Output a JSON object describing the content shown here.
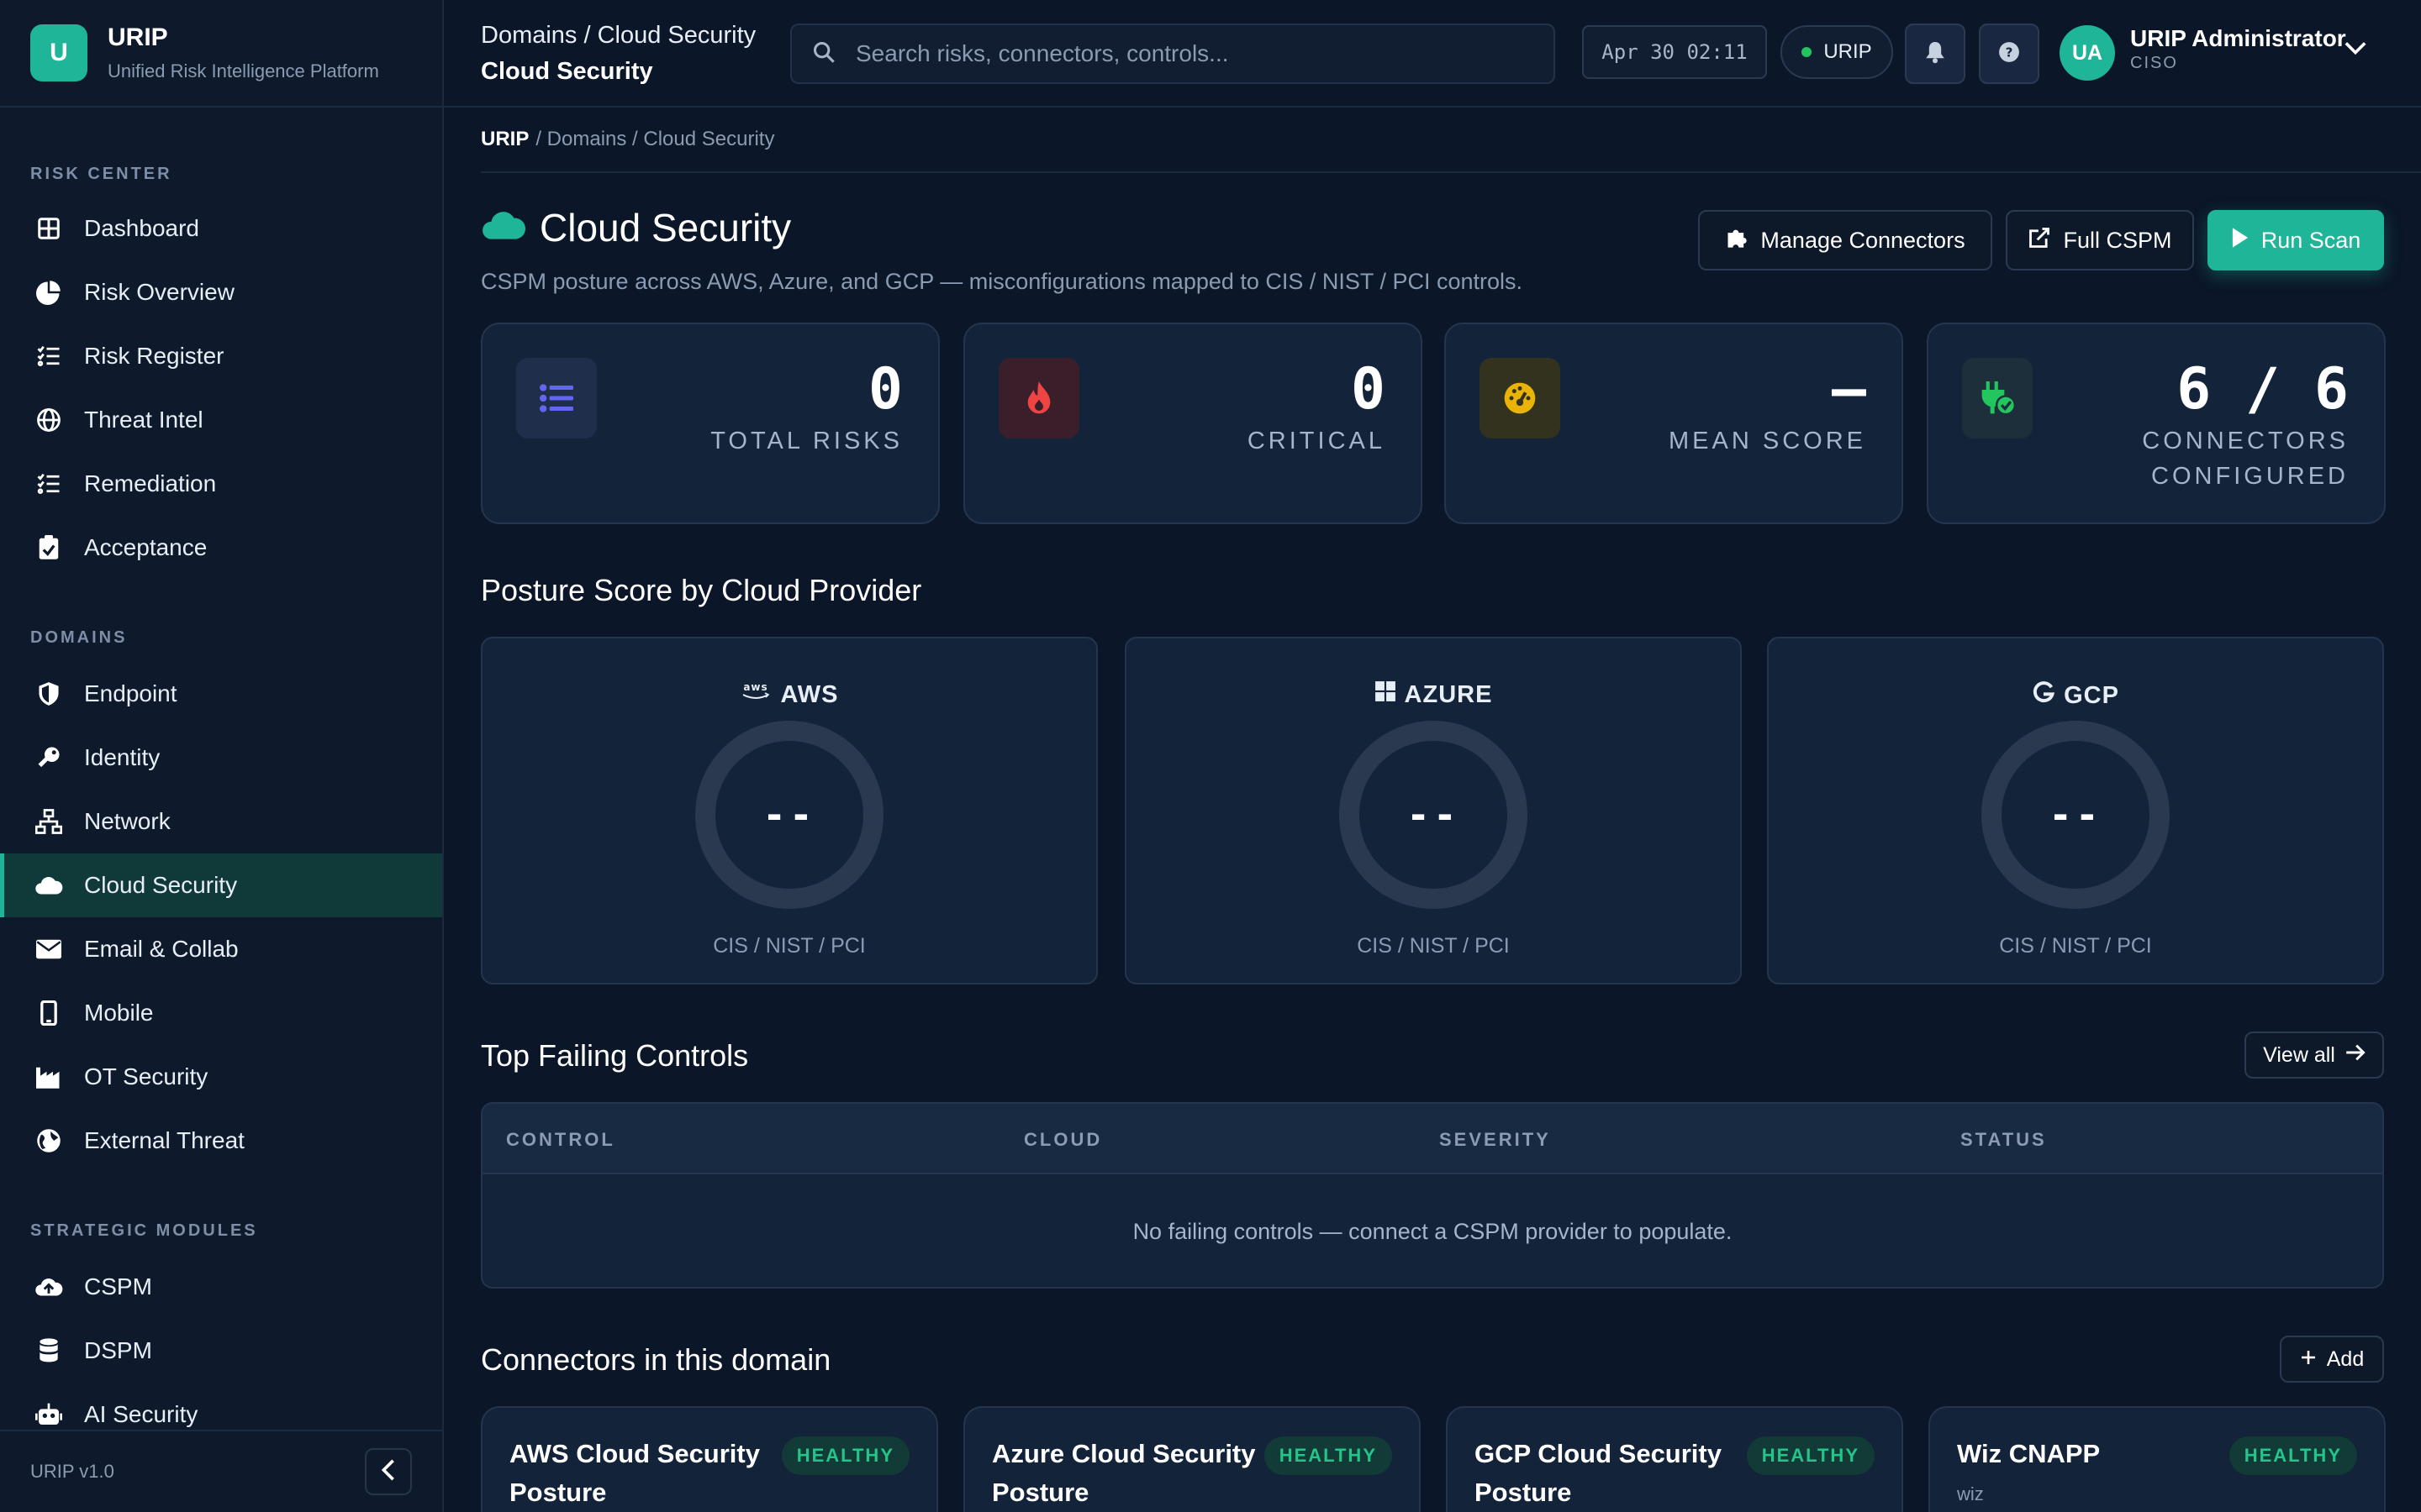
{
  "app": {
    "name": "URIP",
    "tagline": "Unified Risk Intelligence Platform",
    "logo_letter": "U",
    "version": "URIP v1.0"
  },
  "sidebar": {
    "sections": [
      {
        "title": "RISK CENTER",
        "items": [
          {
            "label": "Dashboard",
            "icon": "grid-icon"
          },
          {
            "label": "Risk Overview",
            "icon": "pie-chart-icon"
          },
          {
            "label": "Risk Register",
            "icon": "list-check-icon"
          },
          {
            "label": "Threat Intel",
            "icon": "globe-icon"
          },
          {
            "label": "Remediation",
            "icon": "list-check-icon"
          },
          {
            "label": "Acceptance",
            "icon": "clipboard-check-icon"
          }
        ]
      },
      {
        "title": "DOMAINS",
        "items": [
          {
            "label": "Endpoint",
            "icon": "shield-icon"
          },
          {
            "label": "Identity",
            "icon": "key-icon"
          },
          {
            "label": "Network",
            "icon": "network-icon"
          },
          {
            "label": "Cloud Security",
            "icon": "cloud-icon",
            "active": true
          },
          {
            "label": "Email & Collab",
            "icon": "envelope-icon"
          },
          {
            "label": "Mobile",
            "icon": "mobile-icon"
          },
          {
            "label": "OT Security",
            "icon": "industry-icon"
          },
          {
            "label": "External Threat",
            "icon": "earth-icon"
          }
        ]
      },
      {
        "title": "STRATEGIC MODULES",
        "items": [
          {
            "label": "CSPM",
            "icon": "cloud-upload-icon"
          },
          {
            "label": "DSPM",
            "icon": "database-icon"
          },
          {
            "label": "AI Security",
            "icon": "robot-icon"
          }
        ]
      }
    ]
  },
  "topbar": {
    "title_line1": "Domains / Cloud Security",
    "title_line2": "Cloud Security",
    "search_placeholder": "Search risks, connectors, controls...",
    "clock": "Apr 30 02:11",
    "tenant": "URIP",
    "user_initials": "UA",
    "user_name": "URIP Administrator",
    "user_role": "CISO"
  },
  "breadcrumb": {
    "root": "URIP",
    "rest": "/ Domains / Cloud Security"
  },
  "page": {
    "title": "Cloud Security",
    "subtitle": "CSPM posture across AWS, Azure, and GCP — misconfigurations mapped to CIS / NIST / PCI controls.",
    "buttons": {
      "manage": "Manage Connectors",
      "full": "Full CSPM",
      "run": "Run Scan"
    }
  },
  "stats": [
    {
      "value": "0",
      "label_lines": [
        "TOTAL RISKS"
      ],
      "color": "#6366f1"
    },
    {
      "value": "0",
      "label_lines": [
        "CRITICAL"
      ],
      "color": "#ef4444"
    },
    {
      "value": "–",
      "label_lines": [
        "MEAN SCORE"
      ],
      "color": "#eab308"
    },
    {
      "value": "6 / 6",
      "label_lines": [
        "CONNECTORS",
        "CONFIGURED"
      ],
      "color": "#22c55e"
    }
  ],
  "posture": {
    "title": "Posture Score by Cloud Provider",
    "providers": [
      {
        "name": "AWS",
        "score": "--",
        "frameworks": "CIS / NIST / PCI",
        "icon": "aws-icon"
      },
      {
        "name": "AZURE",
        "score": "--",
        "frameworks": "CIS / NIST / PCI",
        "icon": "windows-icon"
      },
      {
        "name": "GCP",
        "score": "--",
        "frameworks": "CIS / NIST / PCI",
        "icon": "google-icon"
      }
    ]
  },
  "controls": {
    "title": "Top Failing Controls",
    "view_all": "View all",
    "columns": [
      "CONTROL",
      "CLOUD",
      "SEVERITY",
      "STATUS"
    ],
    "empty_text": "No failing controls — connect a CSPM provider to populate."
  },
  "connectors": {
    "title": "Connectors in this domain",
    "add_label": "Add",
    "items": [
      {
        "name": "AWS Cloud Security Posture",
        "status": "HEALTHY",
        "sub": ""
      },
      {
        "name": "Azure Cloud Security Posture",
        "status": "HEALTHY",
        "sub": ""
      },
      {
        "name": "GCP Cloud Security Posture",
        "status": "HEALTHY",
        "sub": ""
      },
      {
        "name": "Wiz CNAPP",
        "status": "HEALTHY",
        "sub": "wiz"
      }
    ]
  },
  "colors": {
    "accent": "#1fb598",
    "background": "#0b1628",
    "card": "#12233a",
    "healthy": "#22c58a"
  }
}
